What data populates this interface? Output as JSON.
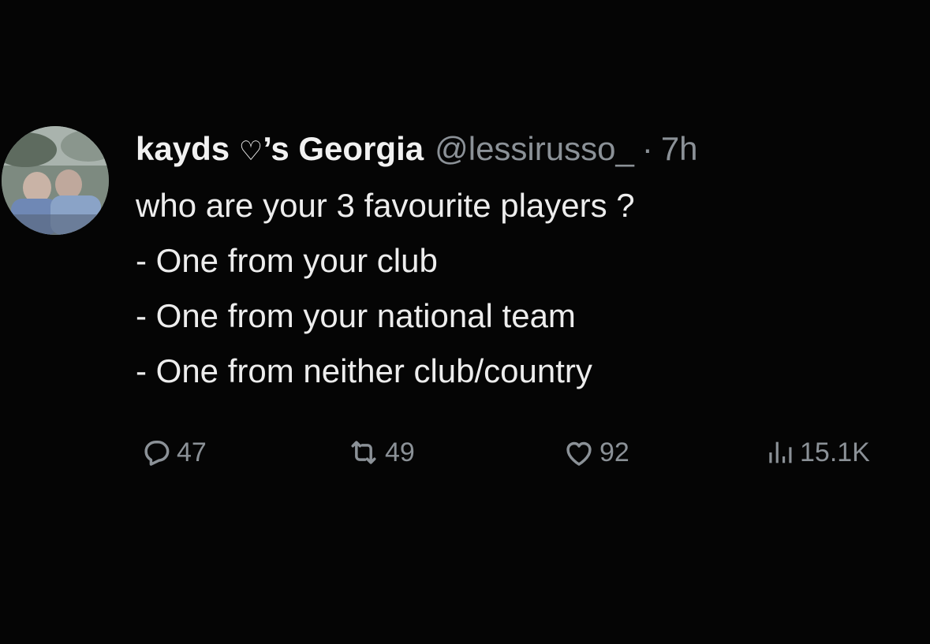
{
  "tweet": {
    "display_name": "kayds",
    "name_icon": "heart-outline-icon",
    "name_heart": "♡",
    "name_suffix": "’s Georgia",
    "handle": "@lessirusso_",
    "separator": "·",
    "time": "7h",
    "text_lines": [
      "who are your 3 favourite players ?",
      "- One from your club",
      "- One from your national team",
      "- One from neither club/country"
    ]
  },
  "actions": {
    "replies": {
      "icon": "reply-icon",
      "count": "47"
    },
    "retweets": {
      "icon": "retweet-icon",
      "count": "49"
    },
    "likes": {
      "icon": "like-heart-icon",
      "count": "92"
    },
    "views": {
      "icon": "views-bar-chart-icon",
      "count": "15.1K"
    }
  },
  "colors": {
    "background": "#050505",
    "primary_text": "#e7e9ea",
    "secondary_text": "#8b9197"
  }
}
